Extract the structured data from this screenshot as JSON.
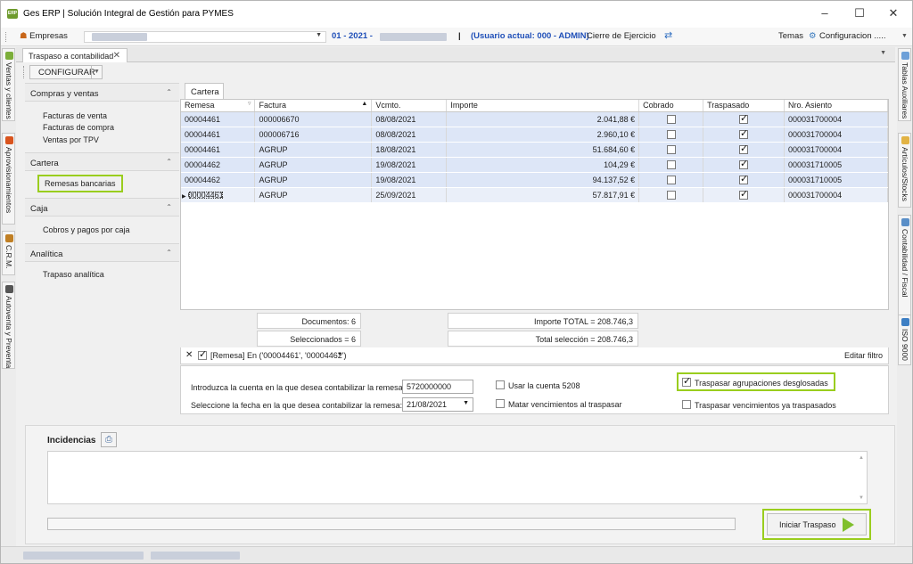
{
  "window": {
    "title": "Ges ERP | Solución Integral de Gestión para PYMES",
    "icon_text": "ERP",
    "controls": [
      "–",
      "☐",
      "✕"
    ]
  },
  "menubar": {
    "empresas_label": "Empresas",
    "period": "01 - 2021 -",
    "separator": "|",
    "user": "(Usuario actual: 000 - ADMIN)",
    "cierre": "Cierre de Ejercicio",
    "temas": "Temas",
    "configuracion": "Configuracion .....",
    "accent": "#1f4fb8"
  },
  "left_tabs": [
    "Ventas y clientes",
    "Aprovisionamientos",
    "C.R.M.",
    "Autoventa y Preventa"
  ],
  "right_tabs": [
    "Tablas Auxiliares",
    "Artículos/Stocks",
    "Contabilidad / Fiscal",
    "ISO 9000"
  ],
  "doc_tab": {
    "label": "Traspaso a contabilidad",
    "close": "✕"
  },
  "config_button": "CONFIGURAR",
  "nav": {
    "groups": [
      {
        "title": "Compras y ventas",
        "items": [
          "Facturas de venta",
          "Facturas de compra",
          "Ventas por TPV"
        ]
      },
      {
        "title": "Cartera",
        "items": [
          "Remesas bancarias"
        ]
      },
      {
        "title": "Caja",
        "items": [
          "Cobros y pagos por caja"
        ]
      },
      {
        "title": "Analítica",
        "items": [
          "Trapaso analítica"
        ]
      }
    ],
    "highlight_color": "#9acd1e"
  },
  "grid": {
    "tab": "Cartera",
    "columns": [
      "Remesa",
      "Factura",
      "Vcmto.",
      "Importe",
      "Cobrado",
      "Traspasado",
      "Nro. Asiento"
    ],
    "rows": [
      {
        "remesa": "00004461",
        "factura": "000006670",
        "vcmto": "08/08/2021",
        "importe": "2.041,88 €",
        "cobrado": false,
        "traspasado": true,
        "asiento": "000031700004"
      },
      {
        "remesa": "00004461",
        "factura": "000006716",
        "vcmto": "08/08/2021",
        "importe": "2.960,10 €",
        "cobrado": false,
        "traspasado": true,
        "asiento": "000031700004"
      },
      {
        "remesa": "00004461",
        "factura": "AGRUP",
        "vcmto": "18/08/2021",
        "importe": "51.684,60 €",
        "cobrado": false,
        "traspasado": true,
        "asiento": "000031700004"
      },
      {
        "remesa": "00004462",
        "factura": "AGRUP",
        "vcmto": "19/08/2021",
        "importe": "104,29 €",
        "cobrado": false,
        "traspasado": true,
        "asiento": "000031710005"
      },
      {
        "remesa": "00004462",
        "factura": "AGRUP",
        "vcmto": "19/08/2021",
        "importe": "94.137,52 €",
        "cobrado": false,
        "traspasado": true,
        "asiento": "000031710005"
      },
      {
        "remesa": "00004461",
        "factura": "AGRUP",
        "vcmto": "25/09/2021",
        "importe": "57.817,91 €",
        "cobrado": false,
        "traspasado": true,
        "asiento": "000031700004"
      }
    ],
    "summary": {
      "documentos": "Documentos: 6",
      "seleccionados": "Seleccionados = 6",
      "importe_total": "Importe TOTAL = 208.746,3",
      "total_seleccion": "Total selección = 208.746,3"
    },
    "filter": {
      "text": "[Remesa] En ('00004461', '00004462')",
      "edit": "Editar filtro"
    }
  },
  "options": {
    "cuenta_label": "Introduzca la cuenta en la que desea contabilizar la remesa:",
    "cuenta_value": "5720000000",
    "fecha_label": "Seleccione la fecha en la que desea contabilizar la remesa:",
    "fecha_value": "21/08/2021",
    "usar_5208": {
      "label": "Usar la cuenta 5208",
      "checked": false
    },
    "matar": {
      "label": "Matar vencimientos al traspasar",
      "checked": false
    },
    "agrupaciones": {
      "label": "Traspasar agrupaciones desglosadas",
      "checked": true
    },
    "ya_traspasados": {
      "label": "Traspasar vencimientos ya traspasados",
      "checked": false
    }
  },
  "incidencias": {
    "title": "Incidencias",
    "start_button": "Iniciar Traspaso",
    "progress": 0
  }
}
